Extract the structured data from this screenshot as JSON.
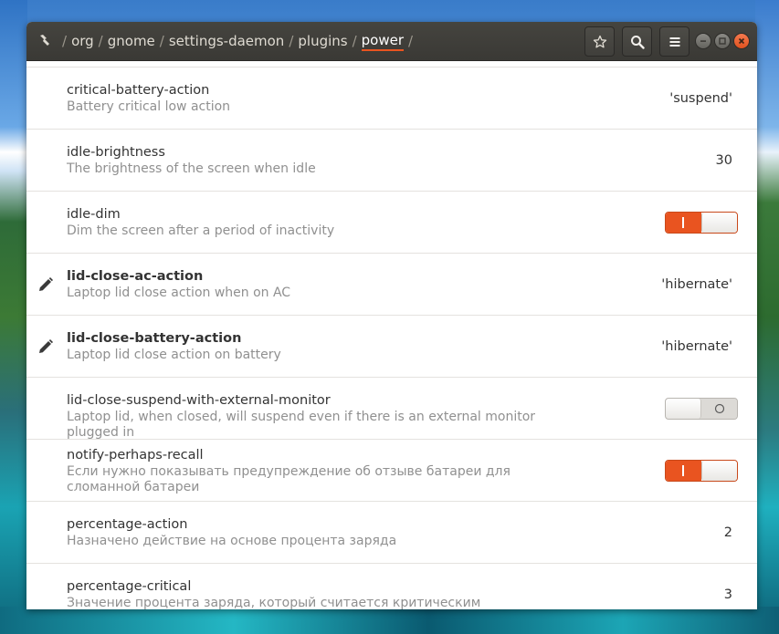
{
  "header": {
    "path": [
      "org",
      "gnome",
      "settings-daemon",
      "plugins",
      "power"
    ],
    "separator": "/"
  },
  "toolbar": {
    "bookmark_icon": "star-icon",
    "search_icon": "search-icon",
    "menu_icon": "hamburger-menu-icon"
  },
  "window_controls": [
    "minimize",
    "maximize",
    "close"
  ],
  "rows": [
    {
      "key": "critical-battery-action",
      "summary": "Battery critical low action",
      "value": "'suspend'",
      "type": "value",
      "modified": false
    },
    {
      "key": "idle-brightness",
      "summary": "The brightness of the screen when idle",
      "value": "30",
      "type": "value",
      "modified": false
    },
    {
      "key": "idle-dim",
      "summary": "Dim the screen after a period of inactivity",
      "type": "toggle",
      "state": true,
      "modified": false
    },
    {
      "key": "lid-close-ac-action",
      "summary": "Laptop lid close action when on AC",
      "value": "'hibernate'",
      "type": "value",
      "modified": true
    },
    {
      "key": "lid-close-battery-action",
      "summary": "Laptop lid close action on battery",
      "value": "'hibernate'",
      "type": "value",
      "modified": true
    },
    {
      "key": "lid-close-suspend-with-external-monitor",
      "summary": "Laptop lid, when closed, will suspend even if there is an external monitor plugged in",
      "type": "toggle",
      "state": false,
      "modified": false
    },
    {
      "key": "notify-perhaps-recall",
      "summary": "Если нужно показывать предупреждение об отзыве батареи для сломанной батареи",
      "type": "toggle",
      "state": true,
      "modified": false
    },
    {
      "key": "percentage-action",
      "summary": "Назначено действие на основе процента заряда",
      "value": "2",
      "type": "value",
      "modified": false
    },
    {
      "key": "percentage-critical",
      "summary": "Значение процента заряда, который считается критическим",
      "value": "3",
      "type": "value",
      "modified": false
    }
  ],
  "colors": {
    "accent": "#e95420",
    "titlebar": "#3c3b37",
    "row_border": "#e4e2df",
    "summary_text": "#909090"
  }
}
